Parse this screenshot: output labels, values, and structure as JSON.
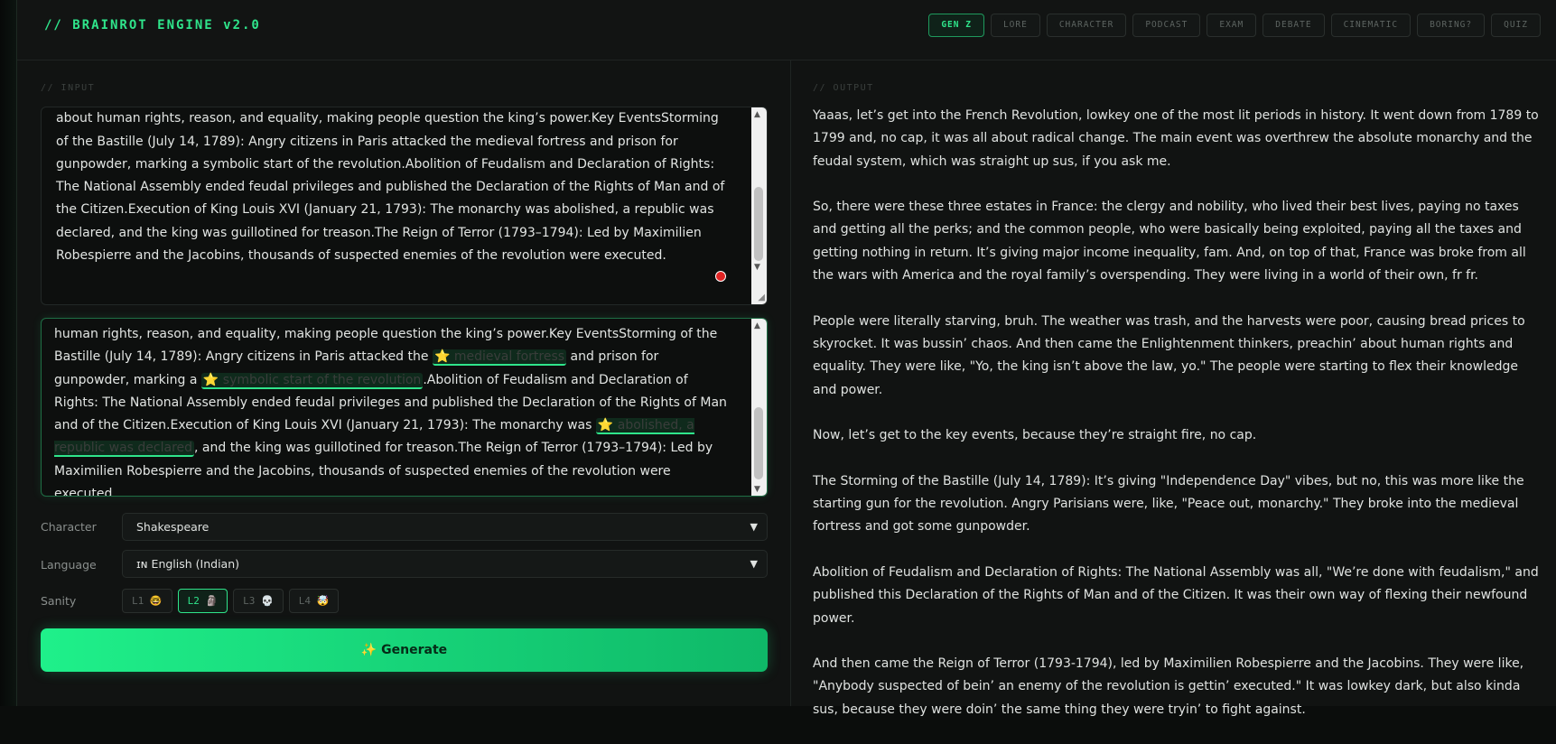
{
  "header": {
    "brand": "// BRAINROT ENGINE v2.0",
    "modes": [
      "GEN Z",
      "LORE",
      "CHARACTER",
      "PODCAST",
      "EXAM",
      "DEBATE",
      "CINEMATIC",
      "BORING?",
      "QUIZ"
    ],
    "active_mode": "GEN Z"
  },
  "input": {
    "label": "// INPUT",
    "source_text": "to skyrocketing bread prices and starvation among the poor.Enlightenment ideas: Thinkers spread ideas about human rights, reason, and equality, making people question the king’s power.Key EventsStorming of the Bastille (July 14, 1789): Angry citizens in Paris attacked the medieval fortress and prison for gunpowder, marking a symbolic start of the revolution.Abolition of Feudalism and Declaration of Rights: The National Assembly ended feudal privileges and published the Declaration of the Rights of Man and of the Citizen.Execution of King Louis XVI (January 21, 1793): The monarchy was abolished, a republic was declared, and the king was guillotined for treason.The Reign of Terror (1793–1794): Led by Maximilien Robespierre and the Jacobins, thousands of suspected enemies of the revolution were executed.",
    "highlight": {
      "t1": "human rights, reason, and equality, making people question the king’s power.Key EventsStorming of the Bastille (July 14, 1789): Angry citizens in Paris attacked the ",
      "h1": "⭐ medieval fortress",
      "t2": " and prison for gunpowder, marking a ",
      "h2": "⭐ symbolic start of the revolution",
      "t3": ".Abolition of Feudalism and Declaration of Rights: The National Assembly ended feudal privileges and published the Declaration of the Rights of Man and of the Citizen.Execution of King Louis XVI (January 21, 1793): The monarchy was ",
      "h3": "⭐ abolished, a republic was declared",
      "t4": ", and the king was guillotined for treason.The Reign of Terror (1793–1794): Led by Maximilien Robespierre and the Jacobins, thousands of suspected enemies of the revolution were executed."
    },
    "character_label": "Character",
    "character_value": "Shakespeare",
    "language_label": "Language",
    "language_value": "ɪɴ English (Indian)",
    "sanity_label": "Sanity",
    "sanity_levels": [
      "L1 🤓",
      "L2 🗿",
      "L3 💀",
      "L4 🤯"
    ],
    "active_sanity": "L2 🗿",
    "generate_label": "✨ Generate"
  },
  "output": {
    "label": "// OUTPUT",
    "paragraphs": [
      "Yaaas, let’s get into the French Revolution, lowkey one of the most lit periods in history. It went down from 1789 to 1799 and, no cap, it was all about radical change. The main event was overthrew the absolute monarchy and the feudal system, which was straight up sus, if you ask me.",
      "So, there were these three estates in France: the clergy and nobility, who lived their best lives, paying no taxes and getting all the perks; and the common people, who were basically being exploited, paying all the taxes and getting nothing in return. It’s giving major income inequality, fam. And, on top of that, France was broke from all the wars with America and the royal family’s overspending. They were living in a world of their own, fr fr.",
      "People were literally starving, bruh. The weather was trash, and the harvests were poor, causing bread prices to skyrocket. It was bussin’ chaos. And then came the Enlightenment thinkers, preachin’ about human rights and equality. They were like, \"Yo, the king isn’t above the law, yo.\" The people were starting to flex their knowledge and power.",
      "Now, let’s get to the key events, because they’re straight fire, no cap.",
      "The Storming of the Bastille (July 14, 1789): It’s giving \"Independence Day\" vibes, but no, this was more like the starting gun for the revolution. Angry Parisians were, like, \"Peace out, monarchy.\" They broke into the medieval fortress and got some gunpowder.",
      "Abolition of Feudalism and Declaration of Rights: The National Assembly was all, \"We’re done with feudalism,\" and published this Declaration of the Rights of Man and of the Citizen. It was their own way of flexing their newfound power.",
      "And then came the Reign of Terror (1793-1794), led by Maximilien Robespierre and the Jacobins. They were like, \"Anybody suspected of bein’ an enemy of the revolution is gettin’ executed.\" It was lowkey dark, but also kinda sus, because they were doin’ the same thing they were tryin’ to fight against."
    ]
  },
  "colors": {
    "accent": "#2fe58b",
    "background": "#111312",
    "highlight_bg": "#0f2a1c"
  }
}
